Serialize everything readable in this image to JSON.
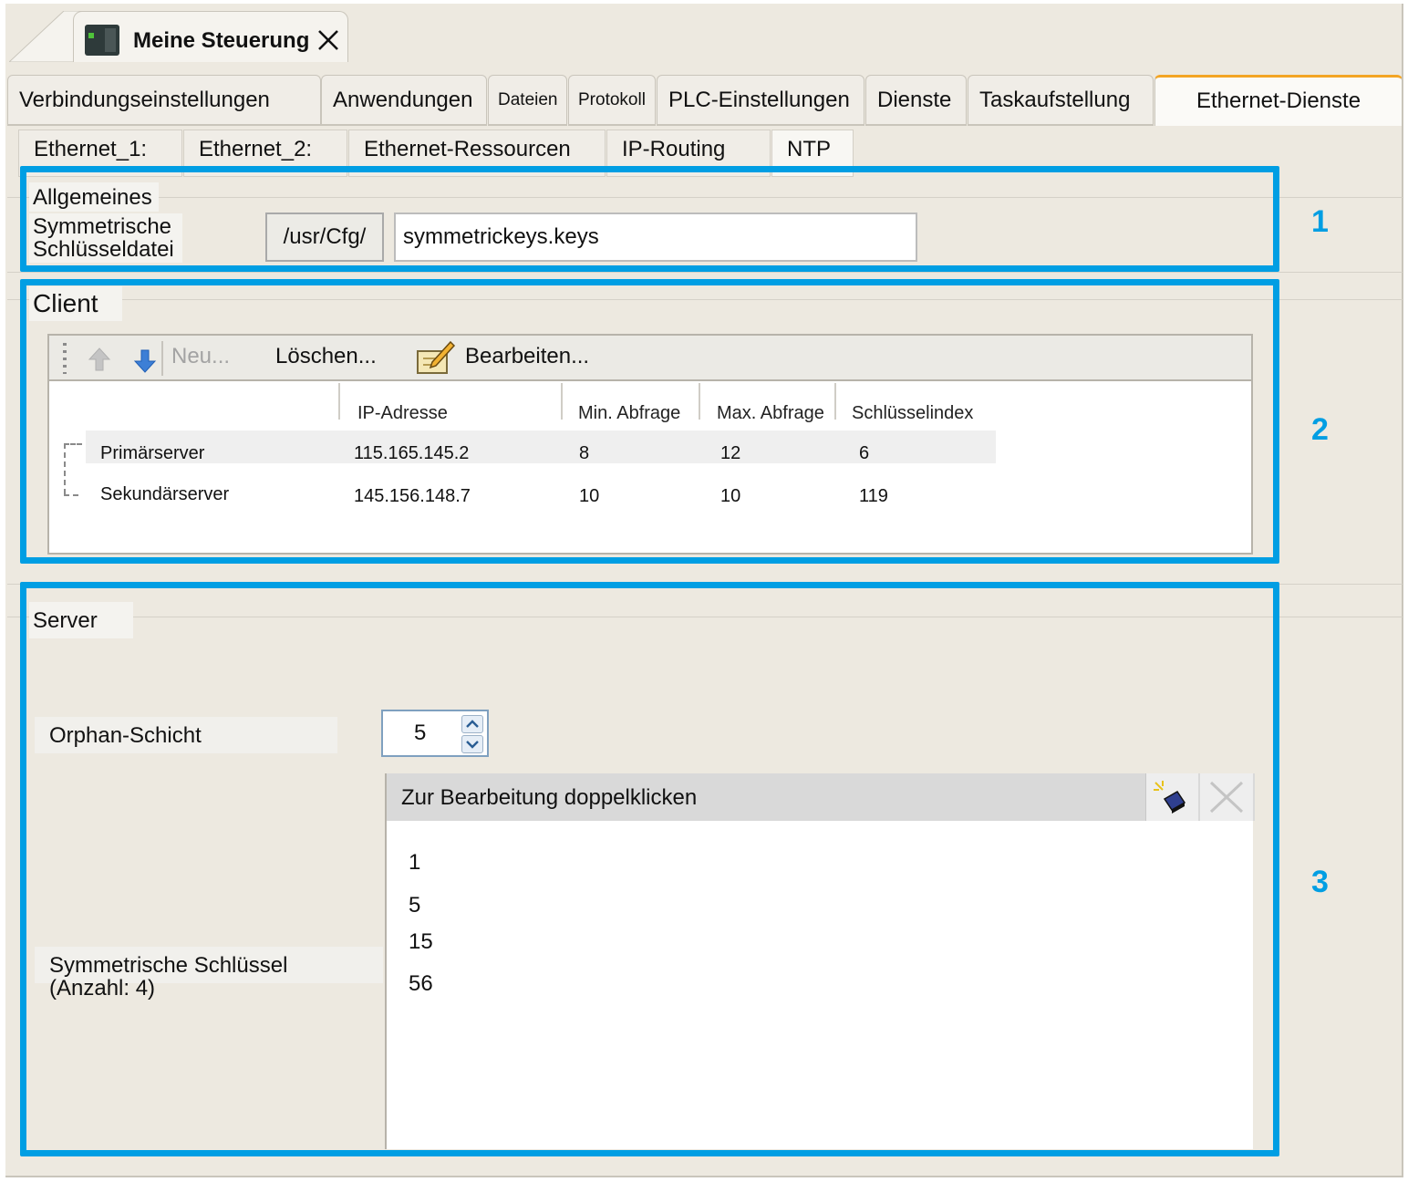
{
  "document_tab": {
    "title": "Meine Steuerung"
  },
  "main_tabs": [
    "Verbindungseinstellungen",
    "Anwendungen",
    "Dateien",
    "Protokoll",
    "PLC-Einstellungen",
    "Dienste",
    "Taskaufstellung",
    "Ethernet-Dienste"
  ],
  "active_main_tab": "Ethernet-Dienste",
  "sub_tabs": [
    "Ethernet_1:",
    "Ethernet_2:",
    "Ethernet-Ressourcen",
    "IP-Routing",
    "NTP"
  ],
  "active_sub_tab": "NTP",
  "callouts": [
    "1",
    "2",
    "3"
  ],
  "general": {
    "section_title": "Allgemeines",
    "file_label_line1": "Symmetrische",
    "file_label_line2": "Schlüsseldatei",
    "path": "/usr/Cfg/",
    "file_value": "symmetrickeys.keys"
  },
  "client": {
    "section_title": "Client",
    "toolbar": {
      "new_label": "Neu...",
      "delete_label": "Löschen...",
      "edit_label": "Bearbeiten..."
    },
    "columns": [
      "IP-Adresse",
      "Min. Abfrage",
      "Max. Abfrage",
      "Schlüsselindex"
    ],
    "rows": [
      {
        "name": "Primärserver",
        "ip": "115.165.145.2",
        "min": "8",
        "max": "12",
        "key": "6"
      },
      {
        "name": "Sekundärserver",
        "ip": "145.156.148.7",
        "min": "10",
        "max": "10",
        "key": "119"
      }
    ]
  },
  "server": {
    "section_title": "Server",
    "orphan_label": "Orphan-Schicht",
    "orphan_value": "5",
    "keys_label_line1": "Symmetrische Schlüssel",
    "keys_label_line2": "(Anzahl: 4)",
    "keys_header": "Zur Bearbeitung doppelklicken",
    "keys": [
      "1",
      "5",
      "15",
      "56"
    ]
  },
  "colors": {
    "highlight": "#009ee3",
    "active_tab_accent": "#f3a524",
    "background": "#ede9e0"
  }
}
